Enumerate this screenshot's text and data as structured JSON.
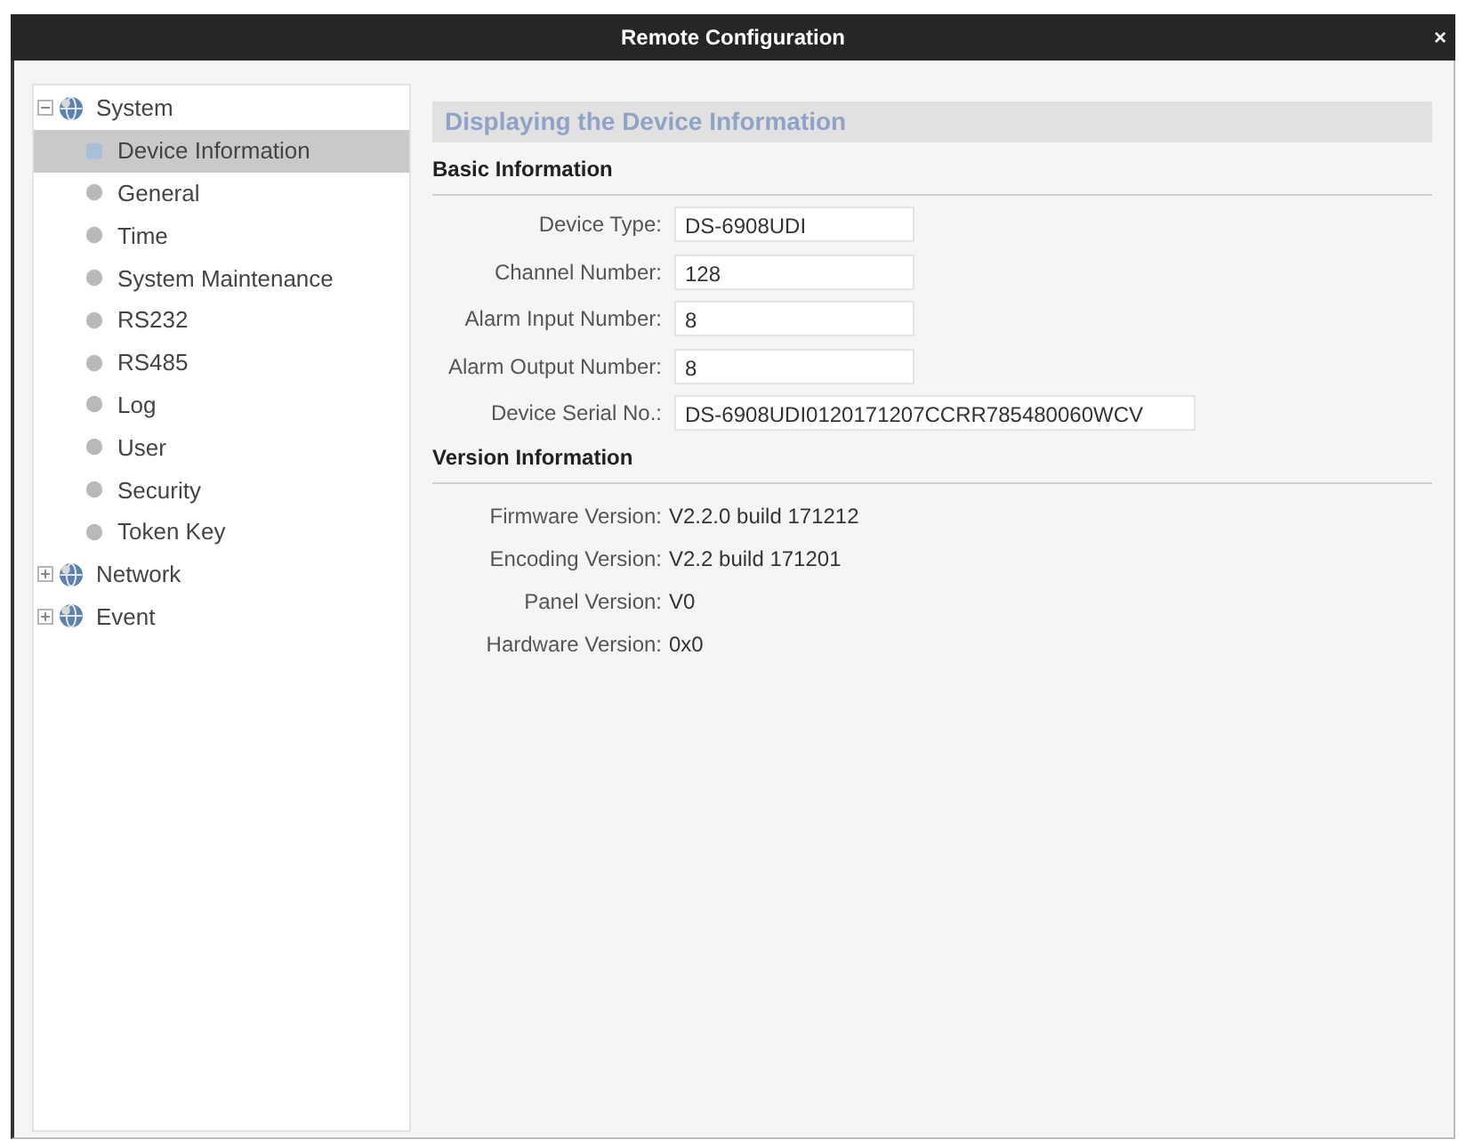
{
  "window": {
    "title": "Remote Configuration",
    "close": "×"
  },
  "tree": [
    {
      "label": "System",
      "expanded": true,
      "selected": false,
      "children": [
        {
          "label": "Device Information",
          "selected": true
        },
        {
          "label": "General",
          "selected": false
        },
        {
          "label": "Time",
          "selected": false
        },
        {
          "label": "System Maintenance",
          "selected": false
        },
        {
          "label": "RS232",
          "selected": false
        },
        {
          "label": "RS485",
          "selected": false
        },
        {
          "label": "Log",
          "selected": false
        },
        {
          "label": "User",
          "selected": false
        },
        {
          "label": "Security",
          "selected": false
        },
        {
          "label": "Token Key",
          "selected": false
        }
      ]
    },
    {
      "label": "Network",
      "expanded": false,
      "selected": false
    },
    {
      "label": "Event",
      "expanded": false,
      "selected": false
    }
  ],
  "page": {
    "title": "Displaying the Device Information",
    "sections": [
      {
        "title": "Basic Information",
        "kind": "fields",
        "rows": [
          {
            "label": "Device Type:",
            "value": "DS-6908UDI"
          },
          {
            "label": "Channel Number:",
            "value": "128"
          },
          {
            "label": "Alarm Input Number:",
            "value": "8"
          },
          {
            "label": "Alarm Output Number:",
            "value": "8"
          },
          {
            "label": "Device Serial No.:",
            "value": "DS-6908UDI0120171207CCRR785480060WCV"
          }
        ]
      },
      {
        "title": "Version Information",
        "kind": "text",
        "rows": [
          {
            "label": "Firmware Version:",
            "value": "V2.2.0 build 171212"
          },
          {
            "label": "Encoding Version:",
            "value": "V2.2 build 171201"
          },
          {
            "label": "Panel Version:",
            "value": "V0"
          },
          {
            "label": "Hardware Version:",
            "value": "0x0"
          }
        ]
      }
    ]
  }
}
